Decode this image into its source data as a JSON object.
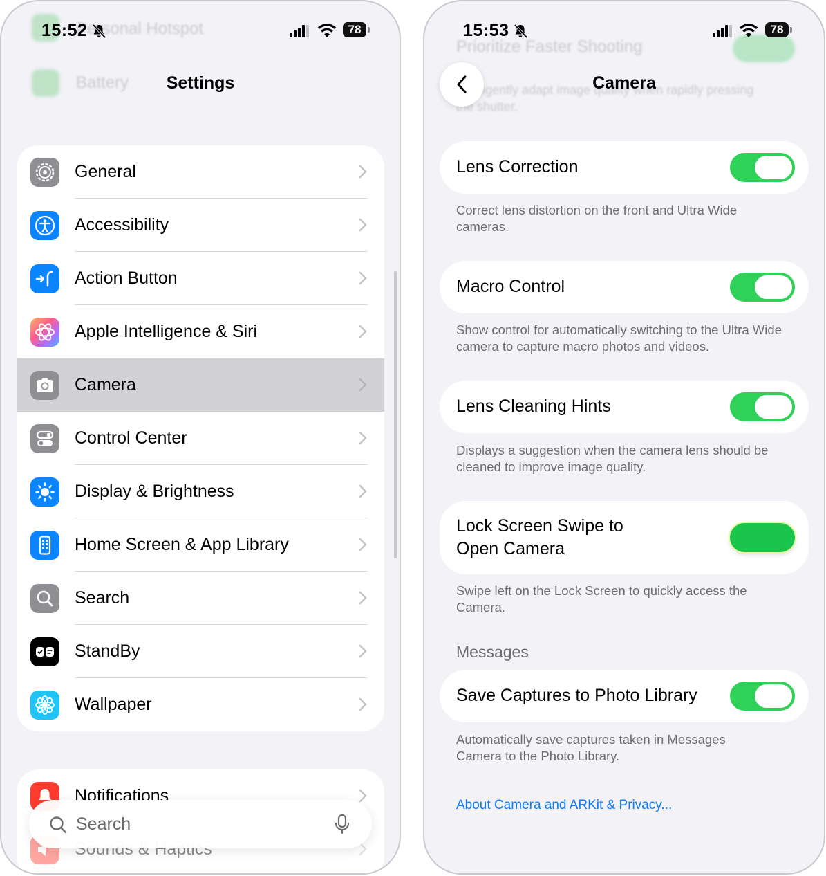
{
  "left": {
    "status": {
      "time": "15:52",
      "battery": "78"
    },
    "ghost": {
      "item1": "Personal Hotspot",
      "item2": "Battery"
    },
    "title": "Settings",
    "items": [
      {
        "label": "General",
        "icon": "gear-icon",
        "color": "#8e8e93"
      },
      {
        "label": "Accessibility",
        "icon": "accessibility-icon",
        "color": "#0a84ff"
      },
      {
        "label": "Action Button",
        "icon": "action-button-icon",
        "color": "#0a84ff"
      },
      {
        "label": "Apple Intelligence & Siri",
        "icon": "siri-icon",
        "color": "#ff6fa5"
      },
      {
        "label": "Camera",
        "icon": "camera-icon",
        "color": "#8e8e93",
        "selected": true
      },
      {
        "label": "Control Center",
        "icon": "control-center-icon",
        "color": "#8e8e93"
      },
      {
        "label": "Display & Brightness",
        "icon": "sun-icon",
        "color": "#0a84ff"
      },
      {
        "label": "Home Screen & App Library",
        "icon": "home-screen-icon",
        "color": "#0a84ff"
      },
      {
        "label": "Search",
        "icon": "search-icon",
        "color": "#8e8e93"
      },
      {
        "label": "StandBy",
        "icon": "standby-icon",
        "color": "#000000"
      },
      {
        "label": "Wallpaper",
        "icon": "flower-icon",
        "color": "#1fc3f5"
      }
    ],
    "group2": [
      {
        "label": "Notifications",
        "icon": "notifications-icon",
        "color": "#ff3b30"
      },
      {
        "label": "Sounds & Haptics",
        "icon": "speaker-icon",
        "color": "#ff3b30"
      }
    ],
    "search_placeholder": "Search"
  },
  "right": {
    "status": {
      "time": "15:53",
      "battery": "78"
    },
    "ghost": {
      "title": "Prioritize Faster Shooting",
      "line1": "Intelligently adapt image quality when rapidly pressing",
      "line2": "the shutter."
    },
    "title": "Camera",
    "settings": [
      {
        "title": "Lens Correction",
        "on": true,
        "note": "Correct lens distortion on the front and Ultra Wide cameras."
      },
      {
        "title": "Macro Control",
        "on": true,
        "note": "Show control for automatically switching to the Ultra Wide camera to capture macro photos and videos."
      },
      {
        "title": "Lens Cleaning Hints",
        "on": true,
        "note": "Displays a suggestion when the camera lens should be cleaned to improve image quality."
      },
      {
        "title": "Lock Screen Swipe to Open Camera",
        "on": true,
        "note": "Swipe left on the Lock Screen to quickly access the Camera."
      }
    ],
    "messages_header": "Messages",
    "save_captures": {
      "title": "Save Captures to Photo Library",
      "on": true,
      "note": "Automatically save captures taken in Messages Camera to the Photo Library."
    },
    "link": "About Camera and ARKit & Privacy..."
  }
}
